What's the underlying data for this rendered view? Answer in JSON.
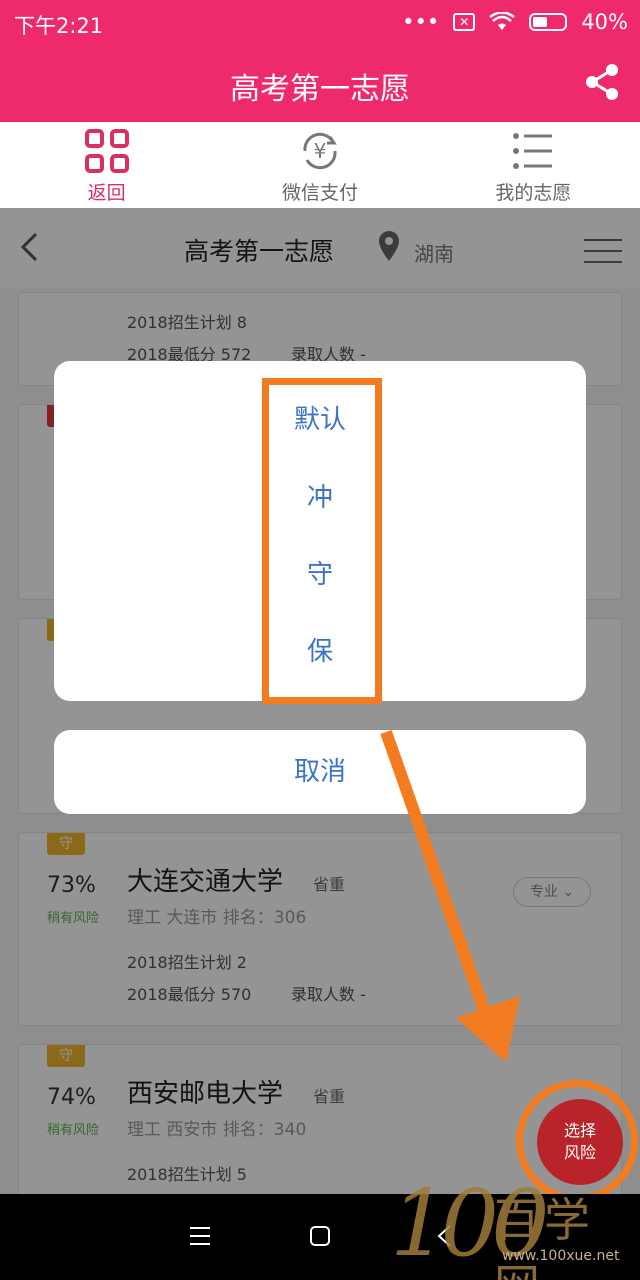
{
  "status_bar": {
    "time": "下午2:21",
    "signal": "•••",
    "battery": "40%"
  },
  "app_bar": {
    "title": "高考第一志愿"
  },
  "top_tabs": [
    {
      "label": "返回",
      "icon": "qr-grid-icon",
      "active": true
    },
    {
      "label": "微信支付",
      "icon": "yuan-refresh-icon",
      "active": false
    },
    {
      "label": "我的志愿",
      "icon": "list-icon",
      "active": false
    }
  ],
  "sub_header": {
    "title": "高考第一志愿",
    "region": "湖南"
  },
  "cards": [
    {
      "plan": "2018招生计划 8",
      "min_score": "2018最低分 572",
      "admitted": "录取人数 -"
    },
    {
      "badge": "守",
      "pct": "73%",
      "risk": "稍有风险",
      "name": "大连交通大学",
      "level": "省重",
      "meta": "理工  大连市  排名：306",
      "plan": "2018招生计划 2",
      "min_score": "2018最低分 570",
      "admitted": "录取人数 -",
      "major_btn": "专业 ⌄"
    },
    {
      "badge": "守",
      "pct": "74%",
      "risk": "稍有风险",
      "name": "西安邮电大学",
      "level": "省重",
      "meta": "理工  西安市  排名：340",
      "plan": "2018招生计划 5"
    }
  ],
  "sheet": {
    "options": [
      "默认",
      "冲",
      "守",
      "保"
    ],
    "cancel": "取消"
  },
  "fab": {
    "line1": "选择",
    "line2": "风险"
  },
  "watermark": {
    "big": "100",
    "cn": "百学网",
    "url": "www.100xue.net"
  },
  "colors": {
    "brand": "#ee2a6d",
    "link": "#3b73c8",
    "annotation": "#f47c20",
    "fab": "#b8242a"
  }
}
